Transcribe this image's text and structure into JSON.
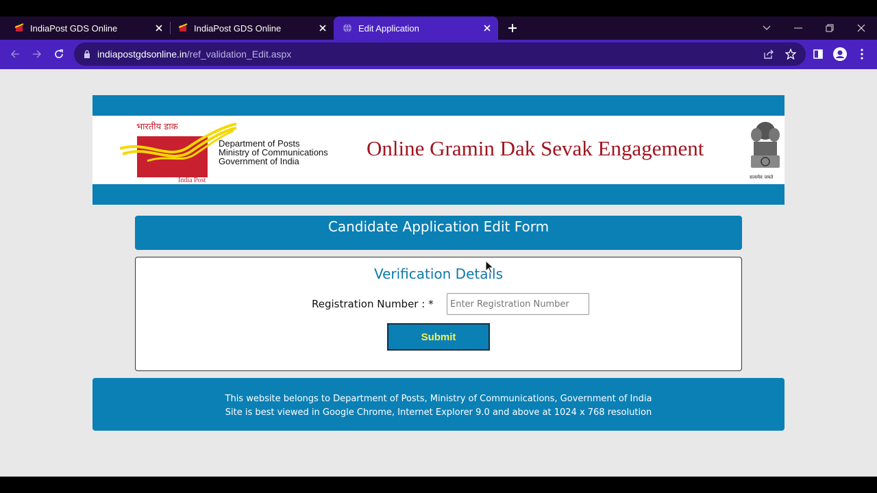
{
  "browser": {
    "tabs": [
      {
        "title": "IndiaPost GDS Online",
        "icon": "indiapost-favicon"
      },
      {
        "title": "IndiaPost GDS Online",
        "icon": "indiapost-favicon"
      },
      {
        "title": "Edit Application",
        "icon": "globe-icon",
        "active": true
      }
    ],
    "address": {
      "domain": "indiapostgdsonline.in",
      "path": "/ref_validation_Edit.aspx"
    },
    "colors": {
      "frame": "#1c0a2e",
      "accent": "#4a22c0",
      "omnibox": "#2c1470"
    }
  },
  "header": {
    "logo_hindi": "भारतीय डाक",
    "logo_caption": "India Post",
    "dept_line1": "Department of Posts",
    "dept_line2": "Ministry of Communications",
    "dept_line3": "Government of India",
    "site_title": "Online Gramin Dak Sevak Engagement",
    "emblem_motto": "सत्यमेव जयते",
    "colors": {
      "bar": "#0b80b5",
      "title": "#a1151f",
      "logo_red": "#c8202f",
      "logo_yellow": "#f5d800"
    }
  },
  "form": {
    "title": "Candidate Application Edit Form",
    "section_title": "Verification Details",
    "registration_label": "Registration Number : *",
    "registration_placeholder": "Enter Registration Number",
    "registration_value": "",
    "submit_label": "Submit",
    "colors": {
      "submit_text": "#f7f05a"
    }
  },
  "footer": {
    "line1": "This website belongs to Department of Posts, Ministry of Communications, Government of India",
    "line2": "Site is best viewed in Google Chrome, Internet Explorer 9.0 and above at 1024 x 768 resolution"
  }
}
